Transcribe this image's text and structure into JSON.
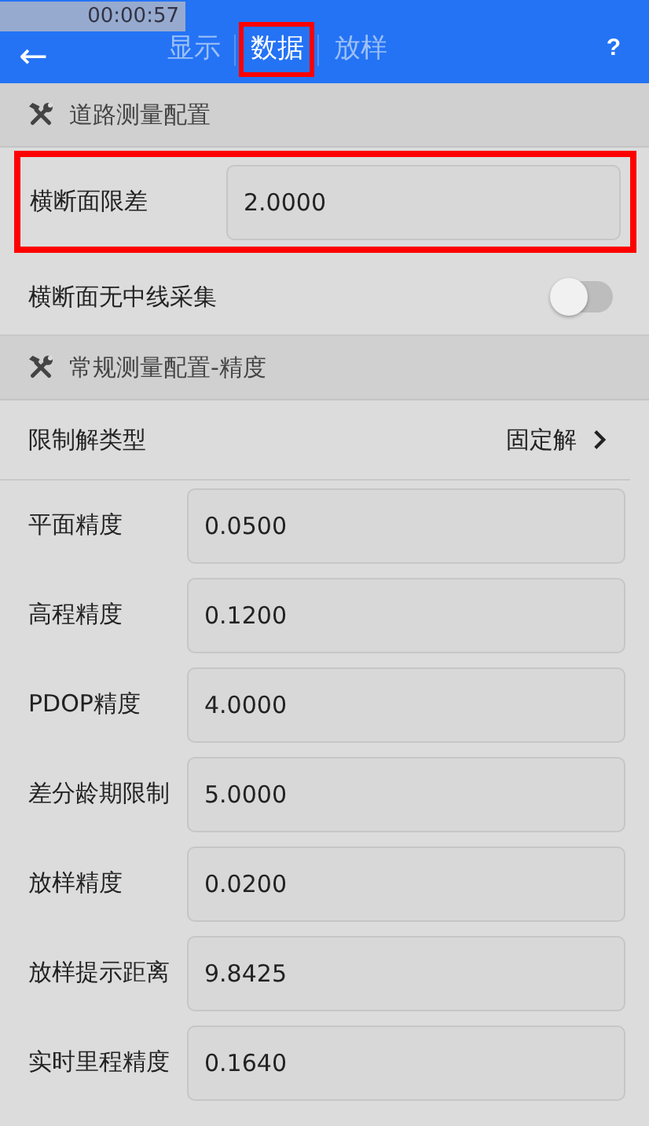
{
  "recorder": {
    "time": "00:00:57"
  },
  "header": {
    "back": "←",
    "help": "?",
    "tabs": [
      {
        "label": "显示",
        "selected": false,
        "highlighted": false
      },
      {
        "label": "数据",
        "selected": true,
        "highlighted": true
      },
      {
        "label": "放样",
        "selected": false,
        "highlighted": false
      }
    ]
  },
  "sections": [
    {
      "title": "道路测量配置",
      "rows": [
        {
          "kind": "field",
          "label": "横断面限差",
          "value": "2.0000",
          "highlighted": true
        },
        {
          "kind": "toggle",
          "label": "横断面无中线采集",
          "on": false
        }
      ]
    },
    {
      "title": "常规测量配置-精度",
      "rows": [
        {
          "kind": "select",
          "label": "限制解类型",
          "value": "固定解"
        },
        {
          "kind": "field",
          "label": "平面精度",
          "value": "0.0500",
          "highlighted": false
        },
        {
          "kind": "field",
          "label": "高程精度",
          "value": "0.1200",
          "highlighted": false
        },
        {
          "kind": "field",
          "label": "PDOP精度",
          "value": "4.0000",
          "highlighted": false
        },
        {
          "kind": "field",
          "label": "差分龄期限制",
          "value": "5.0000",
          "highlighted": false
        },
        {
          "kind": "field",
          "label": "放样精度",
          "value": "0.0200",
          "highlighted": false
        },
        {
          "kind": "field",
          "label": "放样提示距离",
          "value": "9.8425",
          "highlighted": false
        },
        {
          "kind": "field",
          "label": "实时里程精度",
          "value": "0.1640",
          "highlighted": false
        }
      ]
    }
  ]
}
